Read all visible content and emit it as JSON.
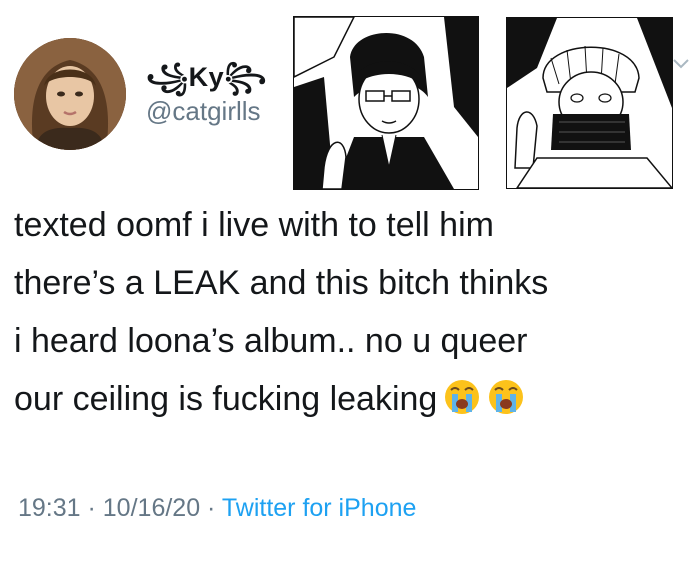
{
  "user": {
    "display_name": "꧁Ky꧂",
    "handle": "@catgirlls"
  },
  "tweet": {
    "lines": [
      "texted oomf i live with to tell him",
      "there’s a LEAK and this bitch thinks",
      "i heard loona’s album.. no u queer",
      "our ceiling is fucking leaking"
    ],
    "emojis": [
      "loudly-crying-face",
      "loudly-crying-face"
    ]
  },
  "meta": {
    "time": "19:31",
    "separator1": " · ",
    "date": "10/16/20",
    "separator2": " · ",
    "source": "Twitter for iPhone"
  },
  "icons": {
    "more": "chevron-down-icon"
  },
  "colors": {
    "secondary_text": "#657786",
    "link": "#1da1f2"
  }
}
